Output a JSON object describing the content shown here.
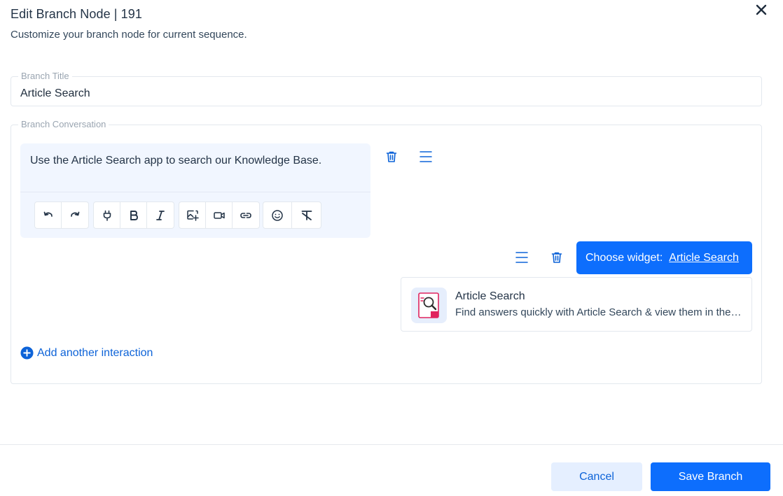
{
  "dialog": {
    "title": "Edit Branch Node | 191",
    "subtitle": "Customize your branch node for current sequence."
  },
  "branch_title": {
    "label": "Branch Title",
    "value": "Article Search"
  },
  "branch_conversation": {
    "label": "Branch Conversation",
    "message_text": "Use the Article Search app to search our Knowledge Base.",
    "toolbar_icons": [
      "undo-icon",
      "redo-icon",
      "plug-icon",
      "bold-icon",
      "italic-icon",
      "image-icon",
      "video-icon",
      "link-icon",
      "emoji-icon",
      "clear-format-icon"
    ]
  },
  "widget": {
    "choose_label": "Choose widget:",
    "selected": "Article Search",
    "card_name": "Article Search",
    "card_description": "Find answers quickly with Article Search & view them in the chat window."
  },
  "add_interaction_label": "Add another interaction",
  "footer": {
    "cancel_label": "Cancel",
    "save_label": "Save Branch"
  },
  "colors": {
    "primary": "#0d6efd",
    "link": "#0d63d8",
    "editor_bg": "#f1f6ff",
    "cancel_bg": "#e5efff"
  }
}
